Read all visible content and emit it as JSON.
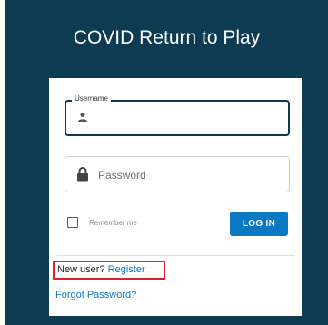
{
  "app": {
    "title": "COVID Return to Play"
  },
  "login": {
    "username_label": "Username",
    "username_value": "",
    "password_placeholder": "Password",
    "remember_label": "Remember me",
    "login_button": "LOG IN",
    "new_user_text": "New user?",
    "register_link": "Register",
    "forgot_link": "Forgot Password?"
  },
  "icons": {
    "username": "person-icon",
    "password": "lock-icon"
  },
  "colors": {
    "background": "#0c3b52",
    "primary": "#0a78c3",
    "highlight": "#d8232a"
  }
}
